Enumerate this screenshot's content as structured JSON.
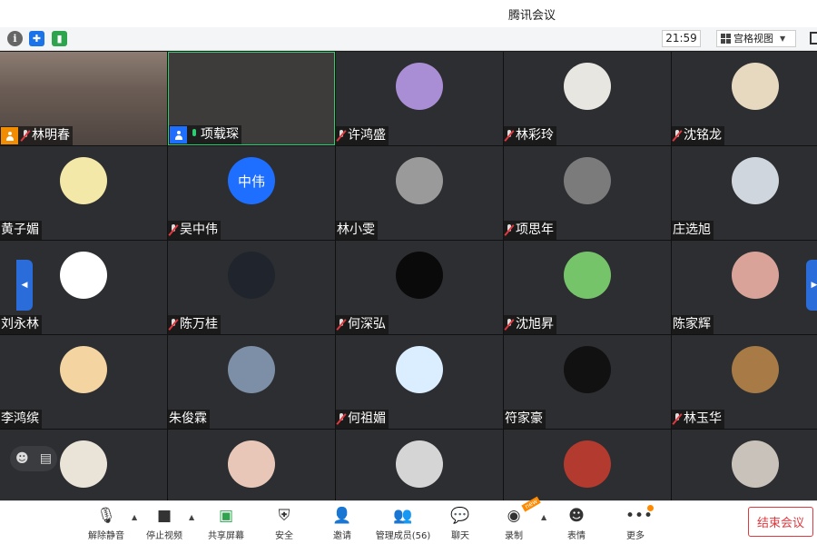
{
  "window": {
    "title": "腾讯会议"
  },
  "toolbar": {
    "time": "21:59",
    "view_mode": "宫格视图"
  },
  "tiles": [
    {
      "name": "林明春",
      "mic": "muted",
      "host": "orange",
      "type": "video"
    },
    {
      "name": "项载琛",
      "mic": "on",
      "host": "blue",
      "type": "video"
    },
    {
      "name": "许鸿盛",
      "mic": "muted",
      "avatar_color": "#a98ed6"
    },
    {
      "name": "林彩玲",
      "mic": "muted",
      "avatar_color": "#e8e6e0"
    },
    {
      "name": "沈铭龙",
      "mic": "muted",
      "avatar_color": "#e7d9bf"
    },
    {
      "name": "黄子媚",
      "mic": "none",
      "avatar_color": "#f3e8a8"
    },
    {
      "name": "吴中伟",
      "mic": "muted",
      "avatar_text": "中伟"
    },
    {
      "name": "林小雯",
      "mic": "none",
      "avatar_color": "#9a9a9a"
    },
    {
      "name": "项思年",
      "mic": "muted",
      "avatar_color": "#7b7b7b"
    },
    {
      "name": "庄选旭",
      "mic": "none",
      "avatar_color": "#cfd6dd"
    },
    {
      "name": "刘永林",
      "mic": "none",
      "avatar_color": "#ffffff"
    },
    {
      "name": "陈万桂",
      "mic": "muted",
      "avatar_color": "#20252d"
    },
    {
      "name": "何深弘",
      "mic": "muted",
      "avatar_color": "#0a0a0a"
    },
    {
      "name": "沈旭昇",
      "mic": "muted",
      "avatar_color": "#76c46a"
    },
    {
      "name": "陈家辉",
      "mic": "none",
      "avatar_color": "#d9a39a"
    },
    {
      "name": "李鸿缤",
      "mic": "none",
      "avatar_color": "#f4d4a0"
    },
    {
      "name": "朱俊霖",
      "mic": "none",
      "avatar_color": "#7d8fa6"
    },
    {
      "name": "何祖媚",
      "mic": "muted",
      "avatar_color": "#dbeeff"
    },
    {
      "name": "符家豪",
      "mic": "none",
      "avatar_color": "#111111"
    },
    {
      "name": "林玉华",
      "mic": "muted",
      "avatar_color": "#a77a46"
    },
    {
      "name": "",
      "mic": "none",
      "avatar_color": "#eae4d8"
    },
    {
      "name": "",
      "mic": "none",
      "avatar_color": "#e8c7b8"
    },
    {
      "name": "",
      "mic": "none",
      "avatar_color": "#d5d5d5"
    },
    {
      "name": "",
      "mic": "none",
      "avatar_color": "#b23a2e"
    },
    {
      "name": "",
      "mic": "none",
      "avatar_color": "#c9c2ba"
    }
  ],
  "controls": {
    "unmute": "解除静音",
    "stop_video": "停止视频",
    "share_screen": "共享屏幕",
    "security": "安全",
    "invite": "邀请",
    "manage_members": "管理成员(56)",
    "chat": "聊天",
    "record": "录制",
    "record_badge": "new",
    "reactions": "表情",
    "more": "更多",
    "end_meeting": "结束会议"
  }
}
